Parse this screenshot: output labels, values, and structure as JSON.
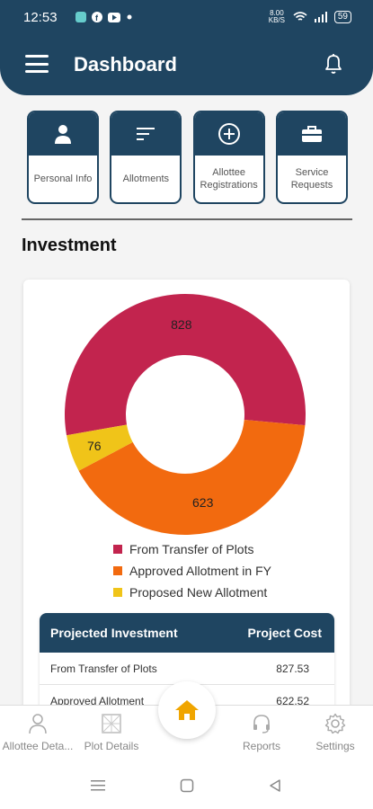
{
  "status": {
    "time": "12:53",
    "speed": "8.00 KB/S",
    "battery": "59"
  },
  "header": {
    "title": "Dashboard"
  },
  "cards": [
    {
      "label": "Personal Info",
      "icon": "person-icon"
    },
    {
      "label": "Allotments",
      "icon": "list-icon"
    },
    {
      "label": "Allottee Registrations",
      "icon": "plus-circle-icon"
    },
    {
      "label": "Service Requests",
      "icon": "briefcase-icon"
    }
  ],
  "section": {
    "title": "Investment"
  },
  "chart_data": {
    "type": "pie",
    "categories": [
      "From Transfer of Plots",
      "Approved Allotment in FY",
      "Proposed New Allotment"
    ],
    "values": [
      828,
      623,
      76
    ],
    "colors": [
      "#c2244e",
      "#f26a0f",
      "#f0c419"
    ]
  },
  "table": {
    "headers": [
      "Projected Investment",
      "Project Cost"
    ],
    "rows": [
      [
        "From Transfer of Plots",
        "827.53"
      ],
      [
        "Approved Allotment",
        "622.52"
      ]
    ]
  },
  "nav": {
    "items": [
      {
        "label": "Allottee Deta..."
      },
      {
        "label": "Plot Details"
      },
      {
        "label": "Reports"
      },
      {
        "label": "Settings"
      }
    ]
  },
  "colors": {
    "primary": "#1f4561",
    "accent": "#f0a500"
  }
}
